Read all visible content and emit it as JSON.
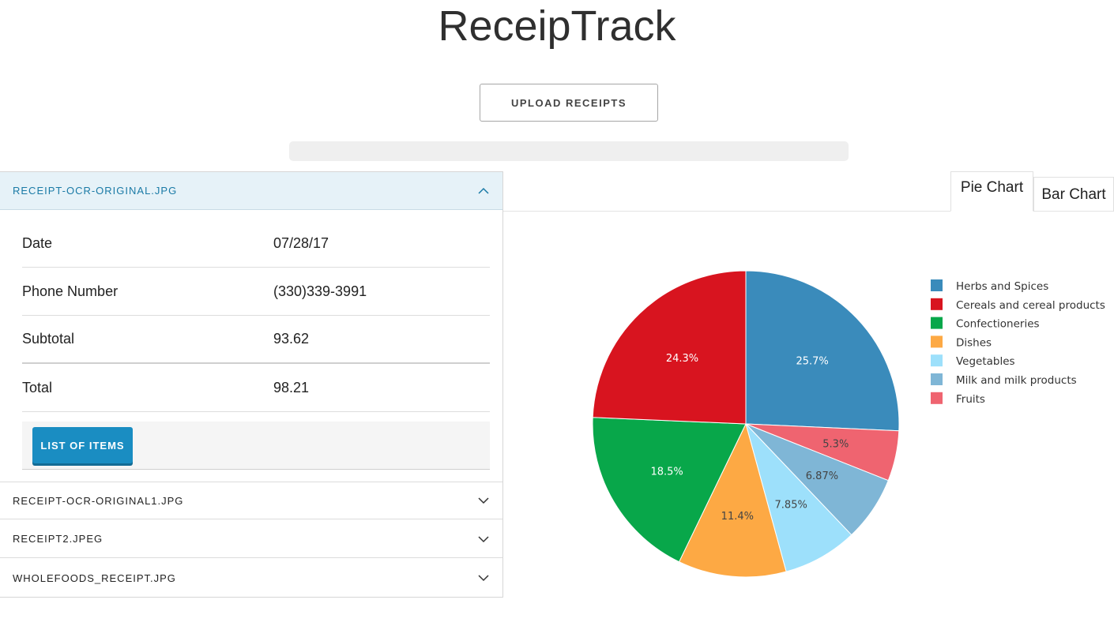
{
  "app": {
    "title": "ReceipTrack"
  },
  "upload": {
    "label": "UPLOAD RECEIPTS"
  },
  "progress": {
    "fraction": 1.0,
    "visible_fill": 0
  },
  "receipts": [
    {
      "name": "RECEIPT-OCR-ORIGINAL.JPG",
      "expanded": true,
      "fields": [
        {
          "label": "Date",
          "value": "07/28/17"
        },
        {
          "label": "Phone Number",
          "value": "(330)339-3991"
        },
        {
          "label": "Subtotal",
          "value": "93.62"
        },
        {
          "label": "Total",
          "value": "98.21"
        }
      ],
      "items_button": "LIST OF ITEMS"
    },
    {
      "name": "RECEIPT-OCR-ORIGINAL1.JPG",
      "expanded": false
    },
    {
      "name": "RECEIPT2.JPEG",
      "expanded": false
    },
    {
      "name": "WHOLEFOODS_RECEIPT.JPG",
      "expanded": false
    }
  ],
  "tabs": [
    {
      "label": "Pie Chart",
      "active": true
    },
    {
      "label": "Bar Chart",
      "active": false
    }
  ],
  "chart_data": {
    "type": "pie",
    "title": "",
    "legend_position": "right",
    "slices": [
      {
        "name": "Herbs and Spices",
        "value": 25.7,
        "label": "25.7%",
        "color": "#3a8bbb"
      },
      {
        "name": "Fruits",
        "value": 5.3,
        "label": "5.3%",
        "color": "#ef6470"
      },
      {
        "name": "Milk and milk products",
        "value": 6.87,
        "label": "6.87%",
        "color": "#7fb6d6"
      },
      {
        "name": "Vegetables",
        "value": 7.85,
        "label": "7.85%",
        "color": "#9de0fb"
      },
      {
        "name": "Dishes",
        "value": 11.4,
        "label": "11.4%",
        "color": "#fda944"
      },
      {
        "name": "Confectioneries",
        "value": 18.5,
        "label": "18.5%",
        "color": "#08a74a"
      },
      {
        "name": "Cereals and cereal products",
        "value": 24.3,
        "label": "24.3%",
        "color": "#d8141f"
      }
    ],
    "legend_order": [
      "Herbs and Spices",
      "Cereals and cereal products",
      "Confectioneries",
      "Dishes",
      "Vegetables",
      "Milk and milk products",
      "Fruits"
    ]
  }
}
